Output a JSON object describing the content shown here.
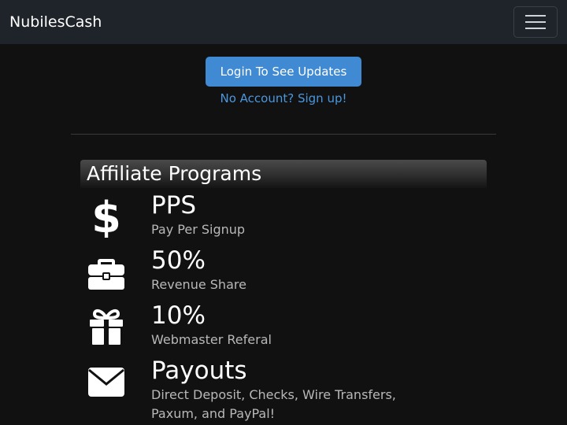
{
  "navbar": {
    "brand": "NubilesCash",
    "toggle_icon": "hamburger-icon"
  },
  "account": {
    "login_label": "Login To See Updates",
    "signup_label": "No Account? Sign up!"
  },
  "affiliate": {
    "heading": "Affiliate Programs",
    "programs": [
      {
        "icon": "dollar-icon",
        "title": "PPS",
        "description": "Pay Per Signup"
      },
      {
        "icon": "briefcase-icon",
        "title": "50%",
        "description": "Revenue Share"
      },
      {
        "icon": "gift-icon",
        "title": "10%",
        "description": "Webmaster Referal"
      },
      {
        "icon": "envelope-icon",
        "title": "Payouts",
        "description": "Direct Deposit, Checks, Wire Transfers, Paxum, and PayPal!"
      }
    ]
  },
  "colors": {
    "navbar_bg": "#1f232a",
    "page_bg": "#111111",
    "primary_button": "#3f8ad2",
    "link": "#4b97dd",
    "muted_text": "#b8b8b8"
  }
}
